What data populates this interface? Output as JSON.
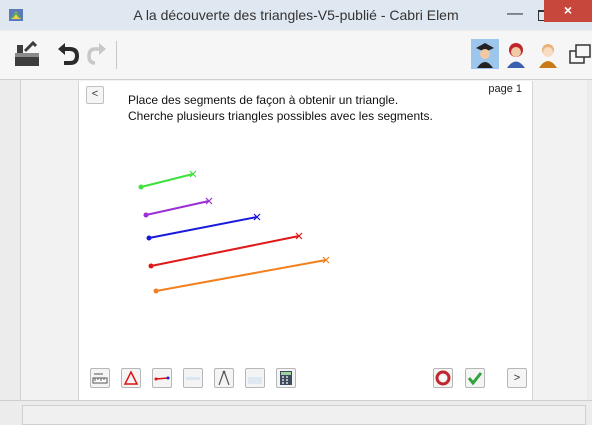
{
  "window": {
    "title": "A la découverte des triangles-V5-publié - Cabri Elem",
    "minimize_glyph": "—",
    "close_glyph": "×"
  },
  "toolbar": {
    "left_icons": [
      "open-file-icon",
      "undo-icon",
      "redo-icon"
    ],
    "right_icons": [
      "teacher-icon",
      "student-icon",
      "author-icon",
      "fullscreen-icon"
    ]
  },
  "page": {
    "number_label": "page 1",
    "back_glyph": "<",
    "next_glyph": ">",
    "instructions": {
      "line1": "Place des segments de façon à obtenir un triangle.",
      "line2": "Cherche plusieurs triangles possibles avec les segments."
    }
  },
  "segments": [
    {
      "color": "#3ee23e",
      "name": "green"
    },
    {
      "color": "#9b2fd6",
      "name": "purple"
    },
    {
      "color": "#1a1adb",
      "name": "blue"
    },
    {
      "color": "#e01818",
      "name": "red"
    },
    {
      "color": "#f2801e",
      "name": "orange"
    }
  ],
  "bottom_tools": [
    "ruler-tool-icon",
    "triangle-tool-icon",
    "segment-tool-icon",
    "blank-tool-icon",
    "compass-tool-icon",
    "eraser-tool-icon",
    "calculator-tool-icon"
  ],
  "actions": [
    "reset-icon",
    "validate-icon"
  ],
  "colors": {
    "close": "#c7473c",
    "validate": "#33a33b"
  }
}
